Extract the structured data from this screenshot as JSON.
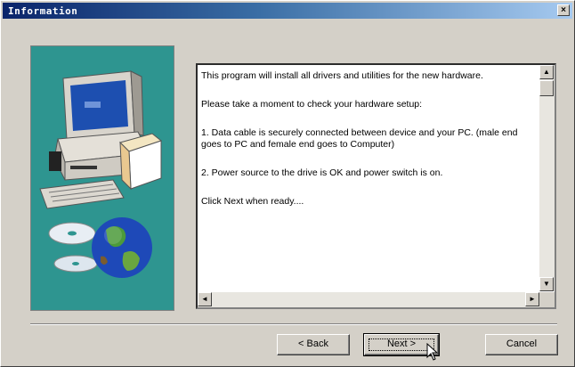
{
  "window": {
    "title": "Information",
    "close_glyph": "×"
  },
  "content": {
    "lines": [
      "This program will install all drivers and utilities for the new hardware.",
      "Please take a moment to check your hardware setup:",
      "1. Data cable is securely connected between device and your PC. (male end goes to PC and female end goes to Computer)",
      "2. Power source to the drive is OK and power switch is on.",
      "Click Next when ready...."
    ]
  },
  "scrollbar": {
    "up_glyph": "▲",
    "down_glyph": "▼",
    "left_glyph": "◄",
    "right_glyph": "►"
  },
  "buttons": {
    "back": "< Back",
    "next": "Next >",
    "cancel": "Cancel"
  },
  "icons": [
    "close-icon",
    "computer-illustration",
    "cd-disc-icon",
    "globe-icon",
    "mouse-cursor-icon"
  ],
  "colors": {
    "title_start": "#0a246a",
    "title_end": "#a6caf0",
    "art_panel": "#2e9590",
    "dialog": "#d4d0c8"
  }
}
